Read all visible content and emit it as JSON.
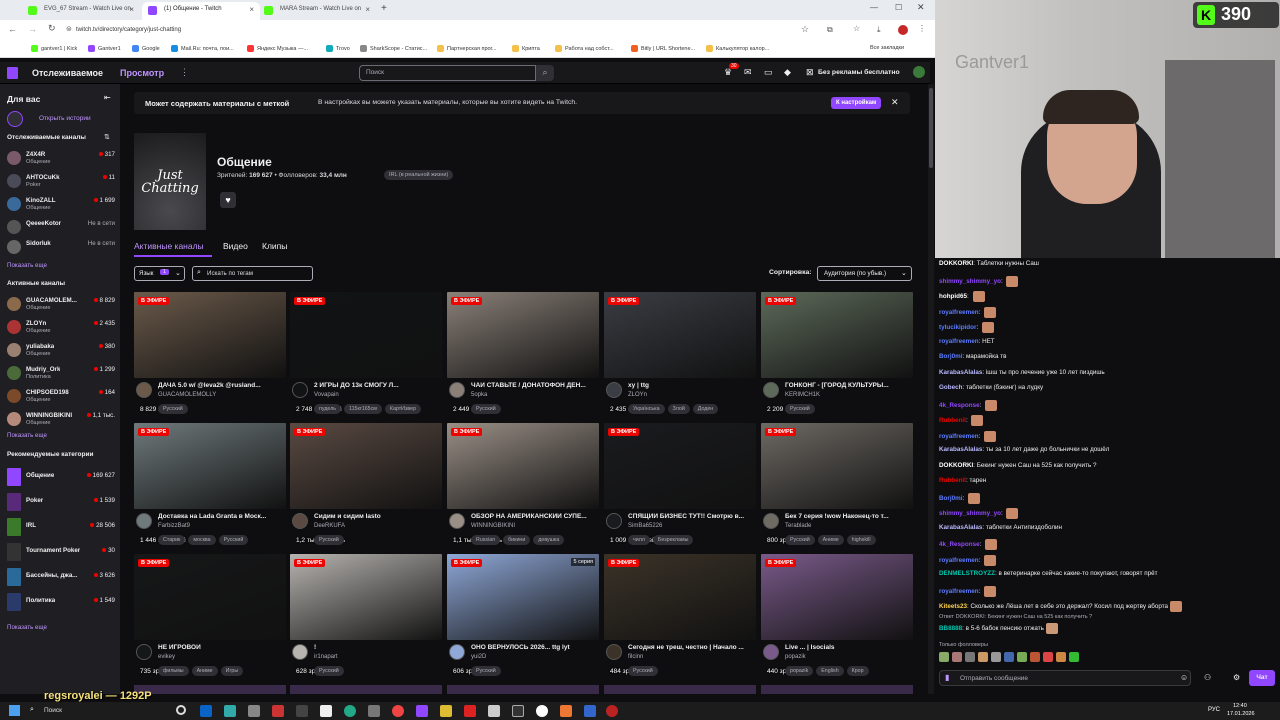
{
  "tabs": [
    {
      "title": "EVG_67 Stream - Watch Live on"
    },
    {
      "title": "(1) Общение - Twitch"
    },
    {
      "title": "MARA Stream - Watch Live on"
    }
  ],
  "address": {
    "url": "twitch.tv/directory/category/just-chatting"
  },
  "bookmarks": [
    "gantver1 | Kick",
    "Gantver1",
    "Google",
    "Mail.Ru: почта, пои...",
    "Яндекс Музыка —...",
    "Trovo",
    "SharkScope - Статис...",
    "Партнерская прог...",
    "Крипта",
    "Работа над собст...",
    "Bitly | URL Shortene...",
    "Калькулятор калор..."
  ],
  "bookmarks_all": "Все закладки",
  "nav": {
    "following": "Отслеживаемое",
    "browse": "Просмотр",
    "search_placeholder": "Поиск",
    "notif_count": "30",
    "ad_free": "Без рекламы бесплатно"
  },
  "sidebar": {
    "for_you": "Для вас",
    "open_stories": "Открыть истории",
    "followed_header": "Отслеживаемые каналы",
    "followed": [
      {
        "name": "Z4X4R",
        "category": "Общение",
        "viewers": "317",
        "live": true
      },
      {
        "name": "AHTOCuKk",
        "category": "Poker",
        "viewers": "11",
        "live": true
      },
      {
        "name": "KinoZALL",
        "category": "Общение",
        "viewers": "1 699",
        "live": true
      },
      {
        "name": "QeeeeKotor",
        "category": "",
        "viewers": "Не в сети",
        "live": false
      },
      {
        "name": "Sidorluk",
        "category": "",
        "viewers": "Не в сети",
        "live": false
      }
    ],
    "show_more": "Показать еще",
    "active_header": "Активные каналы",
    "active": [
      {
        "name": "GUACAMOLEM...",
        "category": "Общение",
        "viewers": "8 829"
      },
      {
        "name": "ZLOYn",
        "category": "Общение",
        "viewers": "2 435"
      },
      {
        "name": "yuliabaka",
        "category": "Общение",
        "viewers": "380"
      },
      {
        "name": "Mudriy_Ork",
        "category": "Политика",
        "viewers": "1 299"
      },
      {
        "name": "CHIPSOED198",
        "category": "Общение",
        "viewers": "164"
      },
      {
        "name": "WINNINGBIKINI",
        "category": "Общение",
        "viewers": "1,1 тыс."
      }
    ],
    "categories_header": "Рекомендуемые категории",
    "categories": [
      {
        "name": "Общение",
        "viewers": "169 627"
      },
      {
        "name": "Poker",
        "viewers": "1 539"
      },
      {
        "name": "IRL",
        "viewers": "28 506"
      },
      {
        "name": "Tournament Poker",
        "viewers": "30"
      },
      {
        "name": "Бассейны, джа...",
        "viewers": "3 626"
      },
      {
        "name": "Политика",
        "viewers": "1 549"
      }
    ]
  },
  "notice": {
    "bold": "Может содержать материалы с меткой",
    "text": "В настройках вы можете указать материалы, которые вы хотите видеть на Twitch.",
    "button": "К настройкам"
  },
  "category": {
    "title": "Общение",
    "cover_text": "Just Chatting",
    "viewers_label": "Зрителей:",
    "viewers": "169 627",
    "followers_label": "Фолловеров:",
    "followers": "33,4 млн",
    "tag": "IRL (в реальной жизни)"
  },
  "tabs_main": [
    "Активные каналы",
    "Видео",
    "Клипы"
  ],
  "filters": {
    "language": "Язык",
    "language_count": "1",
    "tag_placeholder": "Искать по тегам",
    "sort_label": "Сортировка:",
    "sort_value": "Аудитория (по убыв.)"
  },
  "live_label": "В ЭФИРЕ",
  "streams": [
    {
      "views": "8 829 зрителей",
      "title": "ДАЧА 5.0 w/ @leva2k @rusland...",
      "channel": "GUACAMOLEMOLLY",
      "tags": [
        "Русский"
      ],
      "color": "#6b5a4a"
    },
    {
      "views": "2 748 зрителей",
      "title": "2 ИГРЫ ДО 13к СМОГУ Л...",
      "channel": "Vovapain",
      "tags": [
        "пудель",
        "115кг165см",
        "КартИзвер"
      ],
      "color": "#111315"
    },
    {
      "views": "2 449 зрителей",
      "title": "ЧАЙ СТАВЬТЕ / ДОНАТОФОН ДЕН...",
      "channel": "5opka",
      "tags": [
        "Русский"
      ],
      "color": "#8a8078"
    },
    {
      "views": "2 435 зрителей",
      "title": "xy | ttg",
      "channel": "ZLOYn",
      "tags": [
        "Українська",
        "Злой",
        "Доден"
      ],
      "color": "#3a3d44"
    },
    {
      "views": "2 209 зрителей",
      "title": "ГОНКОНГ - [ГОРОД КУЛЬТУРЫ...",
      "channel": "KERIMCH1K",
      "tags": [
        "Русский"
      ],
      "color": "#5d6a5a"
    },
    {
      "views": "1 446 зрителей",
      "title": "Доставка на Lada Granta в Моск...",
      "channel": "FarbizzBat9",
      "tags": [
        "Старик",
        "москва",
        "Русский"
      ],
      "color": "#6f7a7c"
    },
    {
      "views": "1,2 тыс. зритель",
      "title": "Сидим и сидим Iasto",
      "channel": "DeeRKUFA",
      "tags": [
        "Русский"
      ],
      "color": "#5a4a42"
    },
    {
      "views": "1,1 тыс. зритель",
      "title": "ОБЗОР НА АМЕРИКАНСКИЙ СУПЕ...",
      "channel": "WINNINGBIKINI",
      "tags": [
        "Russian",
        "бикини",
        "девушка"
      ],
      "color": "#9a8f86"
    },
    {
      "views": "1 009 зрителей",
      "title": "СПЯЩИЙ БИЗНЕС ТУТ!! Смотрю в...",
      "channel": "SimBa65226",
      "tags": [
        "чилл",
        "Безрекламы"
      ],
      "color": "#1a1b1e"
    },
    {
      "views": "800 зрителей",
      "title": "Бек 7 серия !wow Наконец-то т...",
      "channel": "Terablade",
      "tags": [
        "Русский",
        "Аниме",
        "highskill"
      ],
      "color": "#6e6a64"
    },
    {
      "views": "735 зрителей",
      "title": "НЕ ИГРОВОЙ",
      "channel": "evikey",
      "tags": [
        "фильмы",
        "Аниме",
        "Игры"
      ],
      "color": "#161718"
    },
    {
      "views": "628 зрителей",
      "title": "!",
      "channel": "ir1napart",
      "tags": [
        "Русский"
      ],
      "color": "#b7b4b0"
    },
    {
      "views": "606 зрителей",
      "title": "ОНО ВЕРНУЛОСЬ 2026... ttg lyt",
      "channel": "yui2D",
      "tags": [
        "Русский"
      ],
      "color": "#8fa8d8"
    },
    {
      "views": "484 зрителя",
      "title": "Сегодня не треш, честно | Начало ...",
      "channel": "filcinn",
      "tags": [
        "Русский"
      ],
      "color": "#3b3328"
    },
    {
      "views": "440 зрителей",
      "title": "Live ... | Isocials",
      "channel": "popazik",
      "tags": [
        "popazik",
        "English",
        "Кpop"
      ],
      "color": "#7a5a8a"
    }
  ],
  "series_badge": "5 серия",
  "overlay": {
    "counter": "390",
    "username": "regsroyalei — 1292P"
  },
  "chat": [
    {
      "user": "DOKKORKI",
      "color": "#ffffff",
      "text": "Таблетки нужны Саш",
      "emote": false
    },
    {
      "user": "shimmy_shimmy_yo",
      "color": "#9146ff",
      "text": "",
      "emote": true
    },
    {
      "user": "hohpid65",
      "color": "#ffffff",
      "text": "",
      "emote": true
    },
    {
      "user": "royalfreemen",
      "color": "#5c7cff",
      "text": "",
      "emote": true
    },
    {
      "user": "tylucikipidor",
      "color": "#5c7cff",
      "text": "",
      "emote": true
    },
    {
      "user": "royalfreemen",
      "color": "#5c7cff",
      "text": "НЕТ",
      "emote": false
    },
    {
      "user": "Borj0mi",
      "color": "#5c7cff",
      "text": "марамойка тв",
      "emote": false
    },
    {
      "user": "KarabasAlalas",
      "color": "#b9b9ff",
      "text": "ішш ты про лечение уже 10 лет пиздишь",
      "emote": false
    },
    {
      "user": "Gobech",
      "color": "#b9b9ff",
      "text": "таблетки (бэкинг) на лудку",
      "emote": false
    },
    {
      "user": "4k_Response",
      "color": "#9146ff",
      "text": "",
      "emote": true
    },
    {
      "user": "Rubbenil",
      "color": "#eb0400",
      "text": "",
      "emote": true
    },
    {
      "user": "royalfreemen",
      "color": "#5c7cff",
      "text": "",
      "emote": true
    },
    {
      "user": "KarabasAlalas",
      "color": "#b9b9ff",
      "text": "ты за 10 лет даже до больнички не дошёл",
      "emote": false
    },
    {
      "user": "DOKKORKI",
      "color": "#ffffff",
      "text": "Бекинг нужен Саш на 525 как получить ?",
      "emote": false
    },
    {
      "user": "Rubbenil",
      "color": "#eb0400",
      "text": "тарен",
      "emote": false
    },
    {
      "user": "Borj0mi",
      "color": "#5c7cff",
      "text": "",
      "emote": true
    },
    {
      "user": "shimmy_shimmy_yo",
      "color": "#9146ff",
      "text": "",
      "emote": true
    },
    {
      "user": "KarabasAlalas",
      "color": "#b9b9ff",
      "text": "таблетки Антипиздоболин",
      "emote": false
    },
    {
      "user": "4k_Response",
      "color": "#9146ff",
      "text": "",
      "emote": true
    },
    {
      "user": "royalfreemen",
      "color": "#5c7cff",
      "text": "",
      "emote": true
    },
    {
      "user": "DENMELSTROYZZ",
      "color": "#00c8af",
      "text": "в ветеринарке сейчас какие-то покупают, говорят прёт",
      "emote": false
    },
    {
      "user": "royalfreemen",
      "color": "#5c7cff",
      "text": "",
      "emote": true
    },
    {
      "user": "Kiteets23",
      "color": "#ffd24d",
      "text": "Сколько же Лёша лет в себе это держал? Косил под жертву аборта",
      "emote": true
    }
  ],
  "chat_reply": "Ответ DOKKORKI: Бекинг нужен Саш на 525 как получить ?",
  "chat_last": {
    "user": "BB8888",
    "text": "в 5-6 бабок пенсию отжать"
  },
  "chat_followers_only": "Только фолловеры",
  "chat_input_placeholder": "Отправить сообщение",
  "chat_button": "Чат",
  "taskbar": {
    "search": "Поиск",
    "lang": "РУС",
    "time": "12:40",
    "date": "17.01.2026"
  }
}
